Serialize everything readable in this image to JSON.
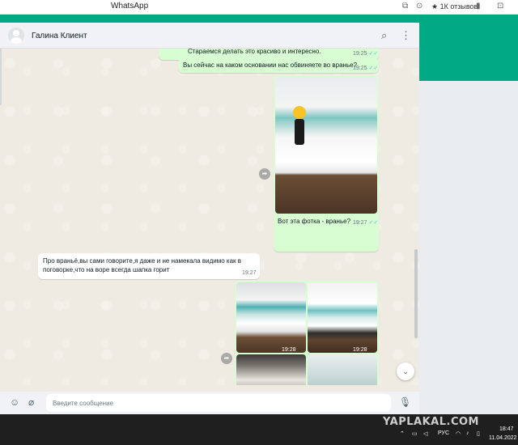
{
  "browser": {
    "window_title": "WhatsApp",
    "reviews_label": "★ 1К отзывов"
  },
  "chat": {
    "contact_name": "Галина Клиент",
    "messages": [
      {
        "direction": "out",
        "text": "Стараемся делать это красиво и интересно.",
        "time": "19:25"
      },
      {
        "direction": "out",
        "text": "Вы сейчас на каком основании нас обвиняете во вранье?",
        "time": "19:25"
      },
      {
        "direction": "out",
        "type": "photo",
        "caption": "Вот эта фотка - вранье?",
        "time": "19:27"
      },
      {
        "direction": "in",
        "text_line1": "Про враньё,вы сами говорите,я даже и не намекала видимо как в",
        "text_line2": "поговорке,что на воре всегда шапка горит",
        "time": "19:27"
      },
      {
        "direction": "out",
        "type": "photo-grid",
        "times": [
          "19:28",
          "19:28"
        ]
      }
    ]
  },
  "compose": {
    "placeholder": "Введите сообщение"
  },
  "taskbar": {
    "watermark": "YAPLAKAL.COM",
    "language": "РУС",
    "time": "18:47",
    "date": "11.04.2022"
  },
  "colors": {
    "brand_green": "#00a884",
    "outgoing_bubble": "#d9fdd3",
    "incoming_bubble": "#ffffff",
    "read_ticks": "#53bdeb"
  },
  "icons": [
    "avatar-placeholder",
    "search-icon",
    "menu-dots-icon",
    "forward-icon",
    "chevron-down-icon",
    "emoji-icon",
    "attach-icon",
    "microphone-icon"
  ]
}
